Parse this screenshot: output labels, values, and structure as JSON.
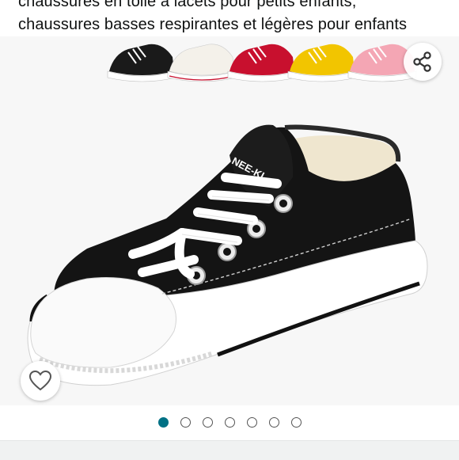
{
  "product": {
    "title_line_1": "chaussures en toile à lacets pour petits enfants,",
    "title_line_2": "chaussures basses respirantes et légères pour enfants"
  },
  "image": {
    "brand_text": "NEE-KI",
    "color_variants": [
      "black",
      "white",
      "red",
      "yellow",
      "pink"
    ],
    "colors": {
      "black": "#1a1a1a",
      "white": "#f4f1ea",
      "red": "#c8102e",
      "yellow": "#f2c500",
      "pink": "#f4a6b4"
    }
  },
  "actions": {
    "share_icon": "share-icon",
    "wishlist_icon": "heart-icon"
  },
  "carousel": {
    "total": 7,
    "active_index": 0,
    "accent_color": "#007185"
  }
}
